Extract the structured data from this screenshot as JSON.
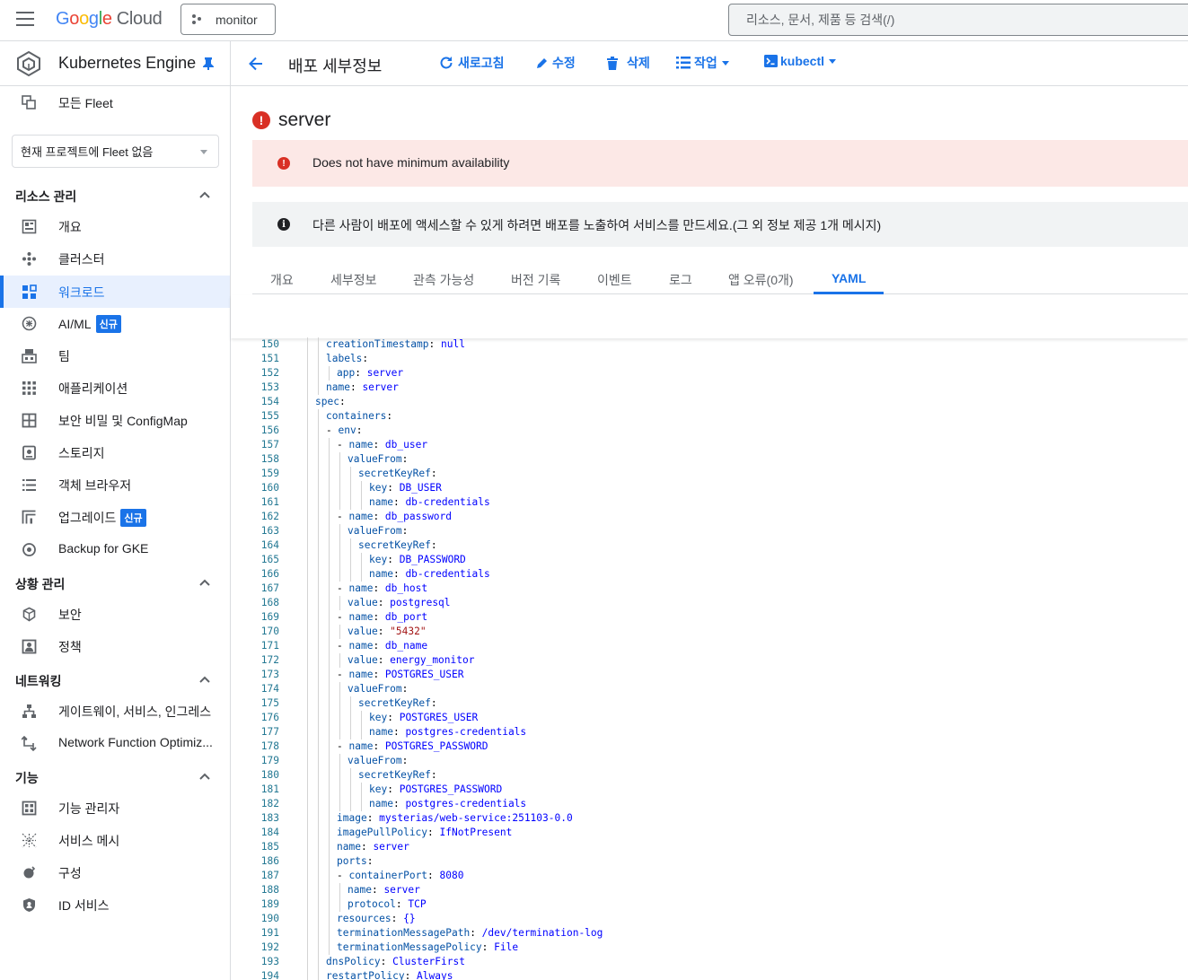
{
  "topbar": {
    "logo_google": "Google",
    "logo_cloud": "Cloud",
    "project": "monitor",
    "search_placeholder": "리소스, 문서, 제품 등 검색(/)"
  },
  "sidebar": {
    "product_title": "Kubernetes Engine",
    "all_fleets": "모든 Fleet",
    "fleet_select": "현재 프로젝트에 Fleet 없음",
    "sections": [
      {
        "title": "리소스 관리",
        "items": [
          {
            "label": "개요",
            "icon": "overview-icon"
          },
          {
            "label": "클러스터",
            "icon": "cluster-icon"
          },
          {
            "label": "워크로드",
            "icon": "workloads-icon",
            "active": true
          },
          {
            "label": "AI/ML",
            "icon": "ai-ml-icon",
            "badge": "신규"
          },
          {
            "label": "팀",
            "icon": "teams-icon"
          },
          {
            "label": "애플리케이션",
            "icon": "applications-icon"
          },
          {
            "label": "보안 비밀 및 ConfigMap",
            "icon": "secrets-configmap-icon"
          },
          {
            "label": "스토리지",
            "icon": "storage-icon"
          },
          {
            "label": "객체 브라우저",
            "icon": "object-browser-icon"
          },
          {
            "label": "업그레이드",
            "icon": "upgrade-icon",
            "badge": "신규"
          },
          {
            "label": "Backup for GKE",
            "icon": "backup-icon"
          }
        ]
      },
      {
        "title": "상황 관리",
        "items": [
          {
            "label": "보안",
            "icon": "security-icon"
          },
          {
            "label": "정책",
            "icon": "policy-icon"
          }
        ]
      },
      {
        "title": "네트워킹",
        "items": [
          {
            "label": "게이트웨이, 서비스, 인그레스",
            "icon": "gateway-icon"
          },
          {
            "label": "Network Function Optimiz...",
            "icon": "network-function-icon"
          }
        ]
      },
      {
        "title": "기능",
        "items": [
          {
            "label": "기능 관리자",
            "icon": "feature-manager-icon"
          },
          {
            "label": "서비스 메시",
            "icon": "service-mesh-icon"
          },
          {
            "label": "구성",
            "icon": "config-icon"
          },
          {
            "label": "ID 서비스",
            "icon": "identity-service-icon"
          }
        ]
      }
    ]
  },
  "toolbar": {
    "title": "배포 세부정보",
    "refresh": "새로고침",
    "edit": "수정",
    "delete": "삭제",
    "actions": "작업",
    "kubectl": "kubectl"
  },
  "resource": {
    "name": "server",
    "error_banner": "Does not have minimum availability",
    "info_banner": "다른 사람이 배포에 액세스할 수 있게 하려면 배포를 노출하여 서비스를 만드세요.(그 외 정보 제공 1개 메시지)"
  },
  "tabs": [
    "개요",
    "세부정보",
    "관측 가능성",
    "버전 기록",
    "이벤트",
    "로그",
    "앱 오류(0개)",
    "YAML"
  ],
  "active_tab": "YAML",
  "yaml_lines": [
    {
      "n": "150",
      "indent": 3,
      "text": "creationTimestamp: null"
    },
    {
      "n": "151",
      "indent": 3,
      "text": "labels:"
    },
    {
      "n": "152",
      "indent": 4,
      "text": "app: server"
    },
    {
      "n": "153",
      "indent": 3,
      "text": "name: server"
    },
    {
      "n": "154",
      "indent": 2,
      "text": "spec:"
    },
    {
      "n": "155",
      "indent": 3,
      "text": "containers:"
    },
    {
      "n": "156",
      "indent": 3,
      "text": "- env:"
    },
    {
      "n": "157",
      "indent": 4,
      "text": "- name: db_user"
    },
    {
      "n": "158",
      "indent": 5,
      "text": "valueFrom:"
    },
    {
      "n": "159",
      "indent": 6,
      "text": "secretKeyRef:"
    },
    {
      "n": "160",
      "indent": 7,
      "text": "key: DB_USER"
    },
    {
      "n": "161",
      "indent": 7,
      "text": "name: db-credentials"
    },
    {
      "n": "162",
      "indent": 4,
      "text": "- name: db_password"
    },
    {
      "n": "163",
      "indent": 5,
      "text": "valueFrom:"
    },
    {
      "n": "164",
      "indent": 6,
      "text": "secretKeyRef:"
    },
    {
      "n": "165",
      "indent": 7,
      "text": "key: DB_PASSWORD"
    },
    {
      "n": "166",
      "indent": 7,
      "text": "name: db-credentials"
    },
    {
      "n": "167",
      "indent": 4,
      "text": "- name: db_host"
    },
    {
      "n": "168",
      "indent": 5,
      "text": "value: postgresql"
    },
    {
      "n": "169",
      "indent": 4,
      "text": "- name: db_port"
    },
    {
      "n": "170",
      "indent": 5,
      "text": "value: \"5432\""
    },
    {
      "n": "171",
      "indent": 4,
      "text": "- name: db_name"
    },
    {
      "n": "172",
      "indent": 5,
      "text": "value: energy_monitor"
    },
    {
      "n": "173",
      "indent": 4,
      "text": "- name: POSTGRES_USER"
    },
    {
      "n": "174",
      "indent": 5,
      "text": "valueFrom:"
    },
    {
      "n": "175",
      "indent": 6,
      "text": "secretKeyRef:"
    },
    {
      "n": "176",
      "indent": 7,
      "text": "key: POSTGRES_USER"
    },
    {
      "n": "177",
      "indent": 7,
      "text": "name: postgres-credentials"
    },
    {
      "n": "178",
      "indent": 4,
      "text": "- name: POSTGRES_PASSWORD"
    },
    {
      "n": "179",
      "indent": 5,
      "text": "valueFrom:"
    },
    {
      "n": "180",
      "indent": 6,
      "text": "secretKeyRef:"
    },
    {
      "n": "181",
      "indent": 7,
      "text": "key: POSTGRES_PASSWORD"
    },
    {
      "n": "182",
      "indent": 7,
      "text": "name: postgres-credentials"
    },
    {
      "n": "183",
      "indent": 4,
      "text": "image: mysterias/web-service:251103-0.0"
    },
    {
      "n": "184",
      "indent": 4,
      "text": "imagePullPolicy: IfNotPresent"
    },
    {
      "n": "185",
      "indent": 4,
      "text": "name: server"
    },
    {
      "n": "186",
      "indent": 4,
      "text": "ports:"
    },
    {
      "n": "187",
      "indent": 4,
      "text": "- containerPort: 8080"
    },
    {
      "n": "188",
      "indent": 5,
      "text": "name: server"
    },
    {
      "n": "189",
      "indent": 5,
      "text": "protocol: TCP"
    },
    {
      "n": "190",
      "indent": 4,
      "text": "resources: {}"
    },
    {
      "n": "191",
      "indent": 4,
      "text": "terminationMessagePath: /dev/termination-log"
    },
    {
      "n": "192",
      "indent": 4,
      "text": "terminationMessagePolicy: File"
    },
    {
      "n": "193",
      "indent": 3,
      "text": "dnsPolicy: ClusterFirst"
    },
    {
      "n": "194",
      "indent": 3,
      "text": "restartPolicy: Always"
    }
  ],
  "colors": {
    "accent": "#1a73e8",
    "error": "#d93025",
    "error_bg": "#fce8e6",
    "info_bg": "#f1f3f4",
    "yaml_key": "#0451a5",
    "yaml_value": "#0000ff",
    "line_number": "#237893"
  }
}
